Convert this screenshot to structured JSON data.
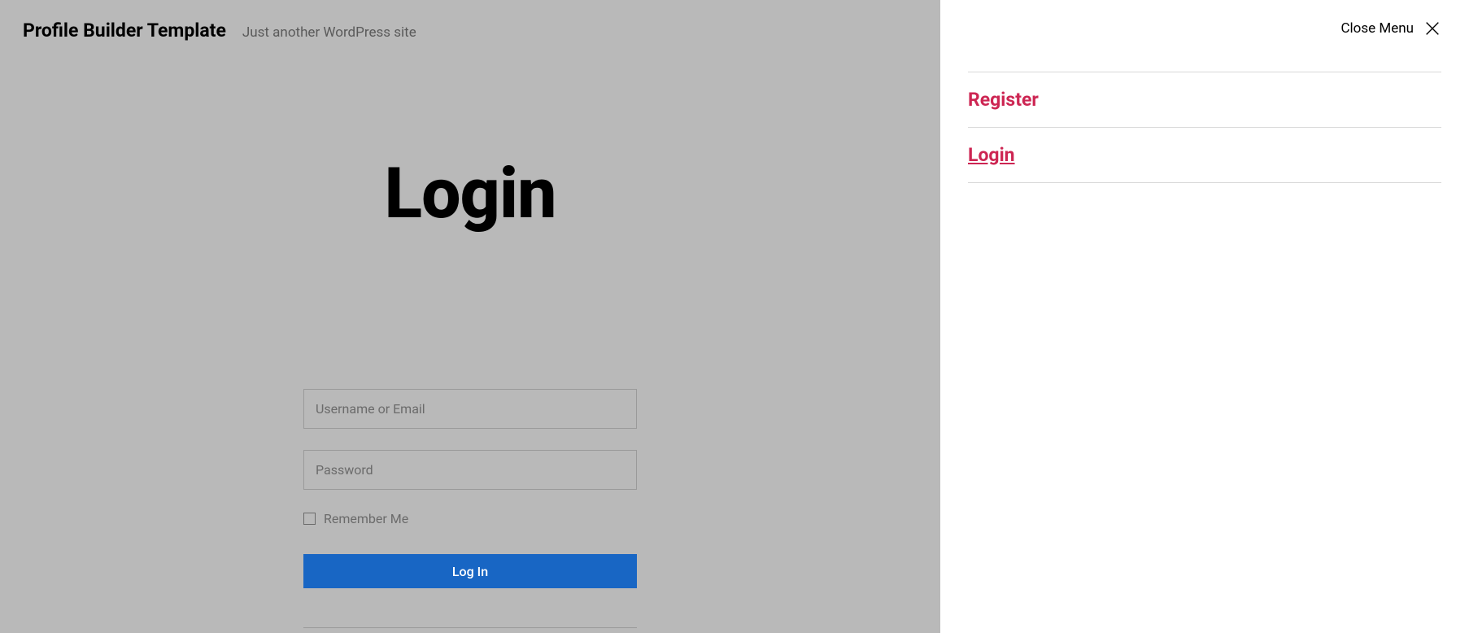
{
  "header": {
    "site_title": "Profile Builder Template",
    "tagline": "Just another WordPress site"
  },
  "page": {
    "title": "Login"
  },
  "form": {
    "username_placeholder": "Username or Email",
    "password_placeholder": "Password",
    "remember_label": "Remember Me",
    "submit_label": "Log In"
  },
  "menu": {
    "close_label": "Close Menu",
    "items": [
      {
        "label": "Register",
        "active": false
      },
      {
        "label": "Login",
        "active": true
      }
    ]
  }
}
